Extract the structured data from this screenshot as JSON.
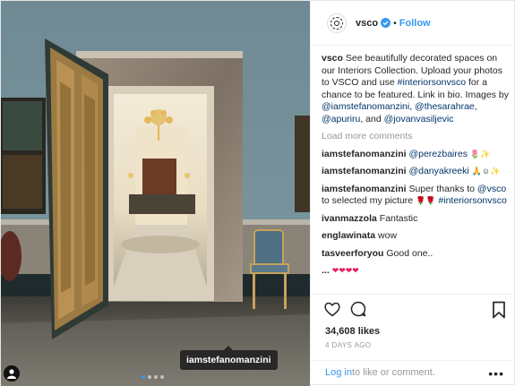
{
  "post": {
    "username": "vsco",
    "follow_label": "Follow",
    "separator": "•",
    "caption": {
      "username": "vsco",
      "text_1": " See beautifully decorated spaces on our Interiors Collection. Upload your photos to VSCO and use ",
      "hashtag": "#interiorsonvsco",
      "text_2": " for a chance to be featured. Link in bio. Images by ",
      "mention_1": "@iamstefanomanzini",
      "text_3": ", ",
      "mention_2": "@thesarahrae",
      "text_4": ", ",
      "mention_3": "@apuriru",
      "text_5": ", and ",
      "mention_4": "@jovanvasiljevic"
    },
    "load_more": "Load more comments",
    "comments": [
      {
        "user": "iamstefanomanzini",
        "mention": "@perezbaires",
        "emoji": "🌷✨"
      },
      {
        "user": "iamstefanomanzini",
        "mention": "@danyakreeki",
        "emoji": "🙏☺✨"
      },
      {
        "user": "iamstefanomanzini",
        "pre": "Super thanks to ",
        "mention": "@vsco",
        "text": " to selected my picture ",
        "emoji": "🌹🌹",
        "hashtag": "#interiorsonvsco"
      },
      {
        "user": "ivanmazzola",
        "text": "Fantastic"
      },
      {
        "user": "englawinata",
        "text": "wow"
      },
      {
        "user": "tasveerforyou",
        "text": "Good one.."
      },
      {
        "user": "...",
        "emoji": "❤❤❤❤"
      }
    ],
    "likes": "34,608 likes",
    "time_ago": "4 DAYS AGO",
    "login_link": "Log in",
    "login_text": " to like or comment.",
    "more_label": "•••",
    "photo_tag": "iamstefanomanzini",
    "carousel": {
      "count": 4,
      "active_index": 0
    },
    "colors": {
      "link": "#003569",
      "accent": "#3897f0",
      "muted": "#999999"
    }
  }
}
